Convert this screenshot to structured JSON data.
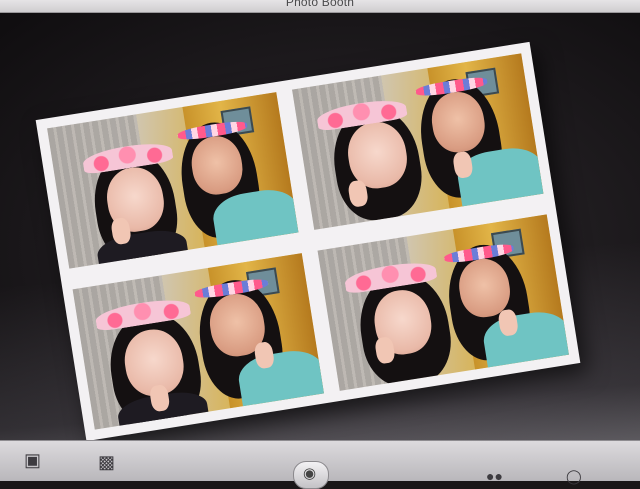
{
  "window": {
    "title": "Photo Booth"
  },
  "stage": {
    "strip": {
      "photos": [
        {
          "id": "top-left"
        },
        {
          "id": "top-right"
        },
        {
          "id": "bottom-left"
        },
        {
          "id": "bottom-right"
        }
      ]
    }
  },
  "toolbar": {
    "left_icons": [
      "person-effect-icon",
      "photo-strip-icon"
    ],
    "center_icon": "camera-icon",
    "right_icon": "effects-icon"
  },
  "colors": {
    "background": "#1a1718",
    "strip_border": "#f3f1f3",
    "toolbar": "#cfcdd1"
  }
}
